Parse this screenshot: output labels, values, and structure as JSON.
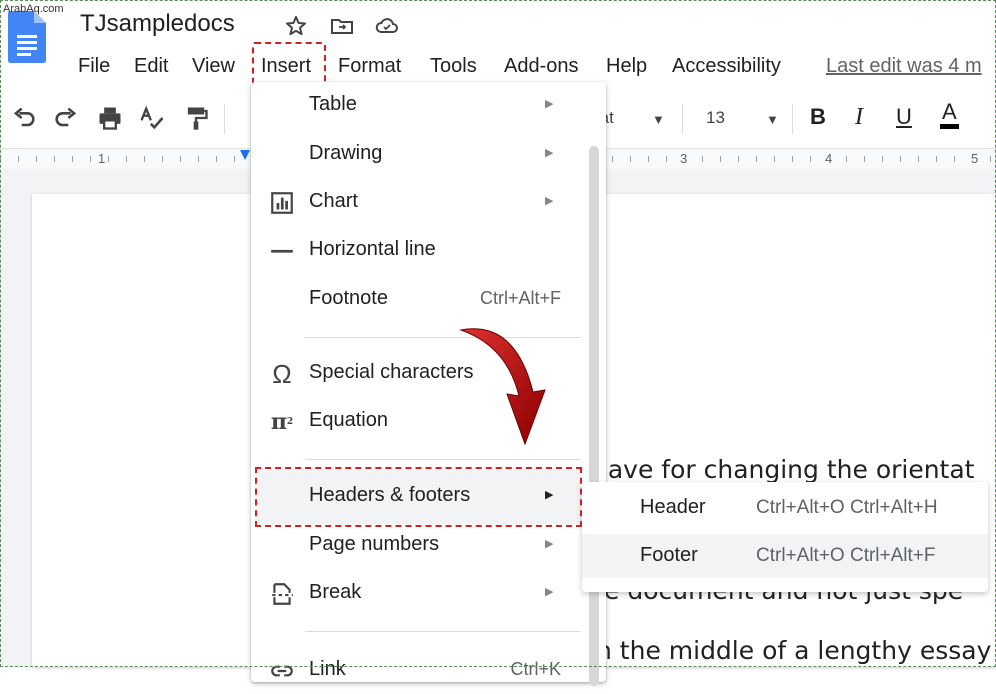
{
  "watermark": "ArabAq.com",
  "doc": {
    "title": "TJsampledocs"
  },
  "menubar": {
    "items": [
      "File",
      "Edit",
      "View",
      "Insert",
      "Format",
      "Tools",
      "Add-ons",
      "Help",
      "Accessibility"
    ],
    "last_edit": "Last edit was 4 m"
  },
  "toolbar": {
    "font_fragment": "rat",
    "font_size": "13",
    "bold": "B",
    "italic": "I",
    "underline": "U",
    "text_color": "A",
    "text_color_value": "#000000"
  },
  "ruler": {
    "labels": [
      "1",
      "3",
      "4",
      "5"
    ]
  },
  "insert_menu": {
    "items": [
      {
        "label": "Table",
        "icon": "none",
        "submenu": true
      },
      {
        "label": "Drawing",
        "icon": "none",
        "submenu": true
      },
      {
        "label": "Chart",
        "icon": "chart-icon",
        "submenu": true
      },
      {
        "label": "Horizontal line",
        "icon": "horizontal-line-icon"
      },
      {
        "label": "Footnote",
        "icon": "none",
        "shortcut": "Ctrl+Alt+F"
      },
      {
        "label": "Special characters",
        "icon": "omega-icon"
      },
      {
        "label": "Equation",
        "icon": "pi-icon"
      },
      {
        "label": "Headers & footers",
        "icon": "none",
        "submenu": true,
        "highlighted": true
      },
      {
        "label": "Page numbers",
        "icon": "none",
        "submenu": true
      },
      {
        "label": "Break",
        "icon": "break-icon",
        "submenu": true
      },
      {
        "label": "Link",
        "icon": "link-icon",
        "shortcut": "Ctrl+K"
      }
    ]
  },
  "headers_footers_submenu": {
    "items": [
      {
        "label": "Header",
        "shortcut": "Ctrl+Alt+O Ctrl+Alt+H"
      },
      {
        "label": "Footer",
        "shortcut": "Ctrl+Alt+O Ctrl+Alt+F",
        "highlighted": true
      }
    ]
  },
  "document_text": {
    "line1": "have for changing the orientat",
    "line2": "e document and not just spe",
    "line3": "n the middle of a lengthy essay"
  },
  "colors": {
    "annotation_red": "#d21f1f",
    "docs_blue": "#4285f4",
    "ruler_marker": "#1a73e8"
  }
}
